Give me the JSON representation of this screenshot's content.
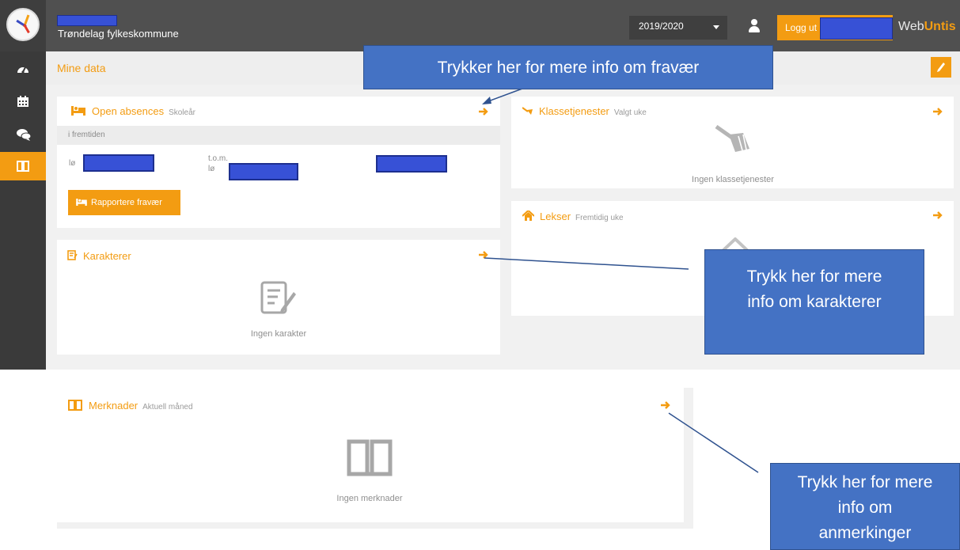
{
  "app": {
    "school_name": "Trøndelag fylkeskommune",
    "brand_prefix": "Web",
    "brand_suffix": "Untis",
    "accent_color": "#f39c12",
    "redaction_color": "#3751d6"
  },
  "header": {
    "school_year": "2019/2020",
    "logout_label": "Logg ut"
  },
  "sidebar": {
    "items": [
      {
        "icon": "dashboard-icon"
      },
      {
        "icon": "calendar-icon"
      },
      {
        "icon": "chat-icon"
      },
      {
        "icon": "book-icon",
        "active": true
      }
    ]
  },
  "page": {
    "title": "Mine data"
  },
  "absences": {
    "title": "Open absences",
    "subtitle": "Skoleår",
    "group_label": "i fremtiden",
    "from_prefix": "lø",
    "to_label": "t.o.m.",
    "to_prefix": "lø",
    "report_button": "Rapportere fravær"
  },
  "class_duties": {
    "title": "Klassetjenester",
    "subtitle": "Valgt uke",
    "empty_text": "Ingen klassetjenester"
  },
  "homework": {
    "title": "Lekser",
    "subtitle": "Fremtidig uke"
  },
  "grades": {
    "title": "Karakterer",
    "empty_text": "Ingen karakter"
  },
  "remarks": {
    "title": "Merknader",
    "subtitle": "Aktuell måned",
    "empty_text": "Ingen merknader"
  },
  "callouts": {
    "absence": "Trykker her for mere info om fravær",
    "grades_line1": "Trykk her for mere",
    "grades_line2": "info om karakterer",
    "remarks_line1": "Trykk her for mere",
    "remarks_line2": "info om",
    "remarks_line3": "anmerkinger"
  }
}
